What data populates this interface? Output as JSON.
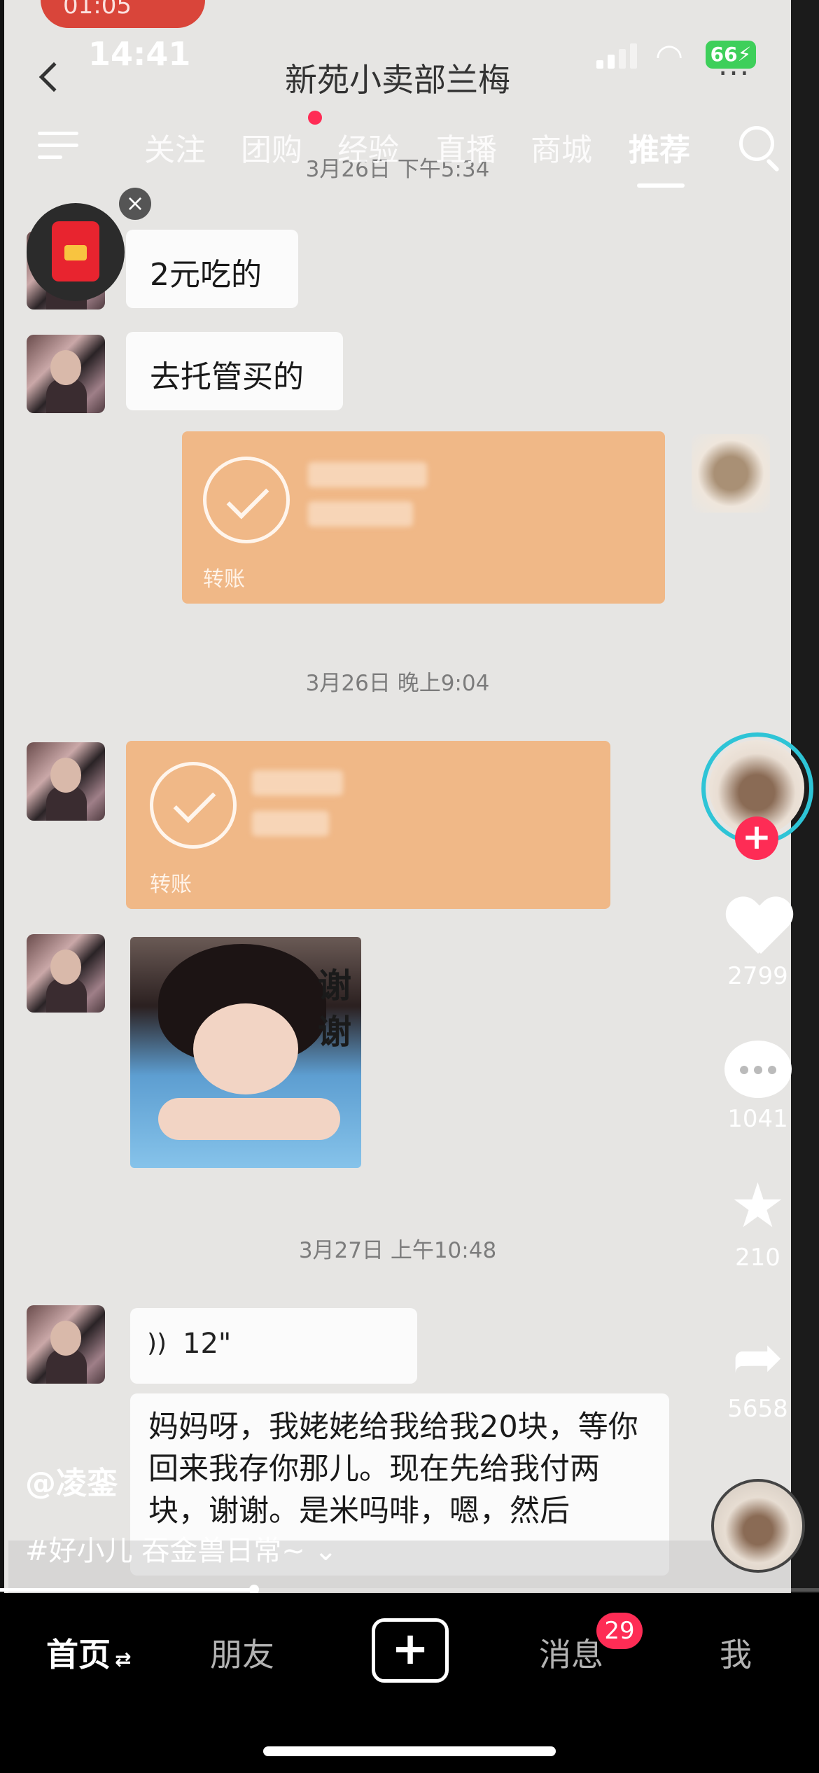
{
  "status_bar": {
    "time": "14:41",
    "battery": "66"
  },
  "recorded_screen": {
    "record_time": "01:05",
    "chat_title": "新苑小卖部兰梅",
    "messages": {
      "ts1": "3月26日 下午5:34",
      "msg1": "2元吃的",
      "msg2": "去托管买的",
      "transfer1_label": "转账",
      "ts2": "3月26日 晚上9:04",
      "transfer2_label": "转账",
      "sticker_text_1": "谢",
      "sticker_text_2": "谢",
      "ts3": "3月27日 上午10:48",
      "voice_duration": "12\"",
      "long_msg": "妈妈呀，我姥姥给我给我20块，等你回来我存你那儿。现在先给我付两块，谢谢。是米吗啡，嗯，然后"
    }
  },
  "top_tabs": [
    "关注",
    "团购",
    "经验",
    "直播",
    "商城",
    "推荐"
  ],
  "active_tab": "推荐",
  "side_actions": {
    "likes": "2799",
    "comments": "1041",
    "favorites": "210",
    "shares": "5658"
  },
  "video_info": {
    "author": "@凌銮",
    "caption": "#好小儿 吞金兽日常~",
    "progress_fraction": 0.31
  },
  "bottom_nav": {
    "home": "首页",
    "friends": "朋友",
    "messages": "消息",
    "messages_badge": "29",
    "me": "我"
  },
  "colors": {
    "accent": "#fe2c55",
    "transfer": "#f0b887"
  }
}
